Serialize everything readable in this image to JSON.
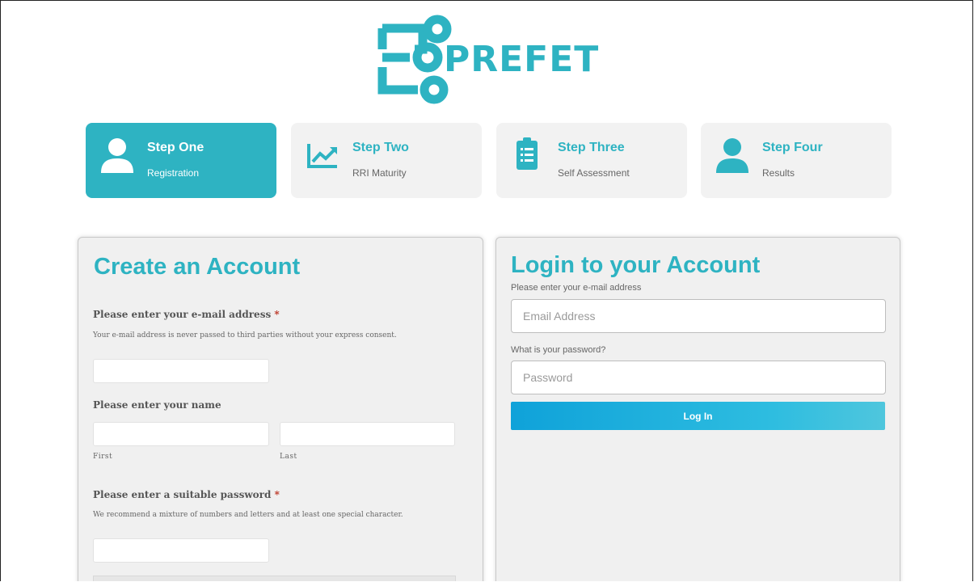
{
  "brand": {
    "name": "PREFET",
    "color": "#2eb3c2"
  },
  "steps": [
    {
      "title": "Step One",
      "subtitle": "Registration",
      "icon": "user-icon",
      "active": true
    },
    {
      "title": "Step Two",
      "subtitle": "RRI Maturity",
      "icon": "chart-icon",
      "active": false
    },
    {
      "title": "Step Three",
      "subtitle": "Self Assessment",
      "icon": "clipboard-icon",
      "active": false
    },
    {
      "title": "Step Four",
      "subtitle": "Results",
      "icon": "user-icon",
      "active": false
    }
  ],
  "create": {
    "heading": "Create an Account",
    "email_label": "Please enter your e-mail address",
    "required_mark": "*",
    "email_help": "Your e-mail address is never passed to third parties without your express consent.",
    "email_value": "",
    "name_label": "Please enter your name",
    "first_value": "",
    "last_value": "",
    "first_sub": "First",
    "last_sub": "Last",
    "password_label": "Please enter a suitable password",
    "password_help": "We recommend a mixture of numbers and letters and at least one special character.",
    "password_value": ""
  },
  "login": {
    "heading": "Login to your Account",
    "email_label": "Please enter your e-mail address",
    "email_placeholder": "Email Address",
    "password_label": "What is your password?",
    "password_placeholder": "Password",
    "button_label": "Log In"
  }
}
